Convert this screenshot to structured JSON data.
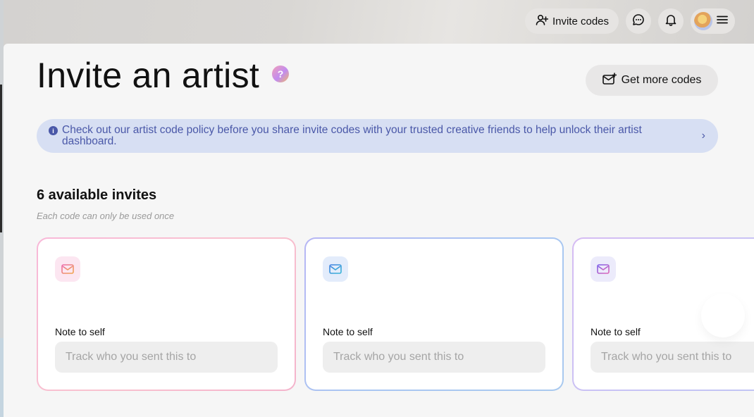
{
  "topbar": {
    "invite_codes_label": "Invite codes",
    "icons": [
      "user-plus-icon",
      "chat-icon",
      "bell-icon",
      "avatar",
      "menu-icon"
    ]
  },
  "page": {
    "title": "Invite an artist",
    "help_badge": "?",
    "get_more_label": "Get more codes"
  },
  "banner": {
    "info_glyph": "i",
    "text": "Check out our artist code policy before you share invite codes with your trusted creative friends to help unlock their artist dashboard.",
    "chevron": "›"
  },
  "invites": {
    "title": "6 available invites",
    "subtitle": "Each code can only be used once",
    "cards": [
      {
        "note_label": "Note to self",
        "placeholder": "Track who you sent this to",
        "accent": "#e86aa8"
      },
      {
        "note_label": "Note to self",
        "placeholder": "Track who you sent this to",
        "accent": "#4f8fe0"
      },
      {
        "note_label": "Note to self",
        "placeholder": "Track who you sent this to",
        "accent": "#8a6ee8"
      }
    ]
  },
  "colors": {
    "banner_bg": "#d7dff3",
    "banner_text": "#4a58a8",
    "panel_bg": "#f6f6f6"
  }
}
